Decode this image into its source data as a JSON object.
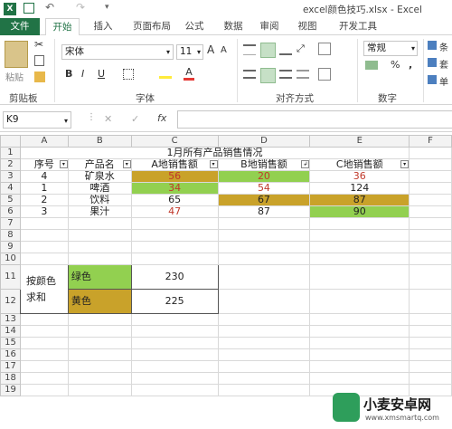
{
  "window": {
    "title": "excel颜色技巧.xlsx - Excel"
  },
  "tabs": {
    "file": "文件",
    "home": "开始",
    "insert": "插入",
    "layout": "页面布局",
    "formulas": "公式",
    "data": "数据",
    "review": "审阅",
    "view": "视图",
    "developer": "开发工具"
  },
  "ribbon": {
    "clipboard": {
      "paste": "粘贴",
      "label": "剪贴板"
    },
    "font": {
      "name": "宋体",
      "size": "11",
      "label": "字体",
      "bold": "B",
      "italic": "I",
      "underline": "U",
      "grow": "A",
      "shrink": "A",
      "font_color": "A"
    },
    "alignment": {
      "label": "对齐方式"
    },
    "number": {
      "format": "常规",
      "label": "数字",
      "percent": "%",
      "comma": ","
    },
    "styles": {
      "item1": "条",
      "item2": "套",
      "item3": "单"
    }
  },
  "formula_bar": {
    "name_box": "K9",
    "fx": "fx",
    "cancel": "✕",
    "enter": "✓",
    "value": ""
  },
  "columns": [
    "",
    "A",
    "B",
    "C",
    "D",
    "E",
    "F"
  ],
  "sheet": {
    "title": "1月所有产品销售情况",
    "headers": [
      "序号",
      "产品名",
      "A地销售额",
      "B地销售额",
      "C地销售额"
    ],
    "rows": [
      {
        "num": "4",
        "name": "矿泉水",
        "a": "56",
        "b": "20",
        "c": "36"
      },
      {
        "num": "1",
        "name": "啤酒",
        "a": "34",
        "b": "54",
        "c": "124"
      },
      {
        "num": "2",
        "name": "饮料",
        "a": "65",
        "b": "67",
        "c": "87"
      },
      {
        "num": "3",
        "name": "果汁",
        "a": "47",
        "b": "87",
        "c": "90"
      }
    ],
    "sum_label_1": "按颜色",
    "sum_label_2": "求和",
    "sum_rows": [
      {
        "label": "绿色",
        "value": "230"
      },
      {
        "label": "黄色",
        "value": "225"
      }
    ],
    "row_numbers": [
      "1",
      "2",
      "3",
      "4",
      "5",
      "6",
      "7",
      "8",
      "9",
      "10",
      "11",
      "12",
      "13",
      "14",
      "15",
      "16",
      "17",
      "18",
      "19"
    ]
  },
  "watermark": {
    "name": "小麦安卓网",
    "url": "www.xmsmartq.com"
  }
}
